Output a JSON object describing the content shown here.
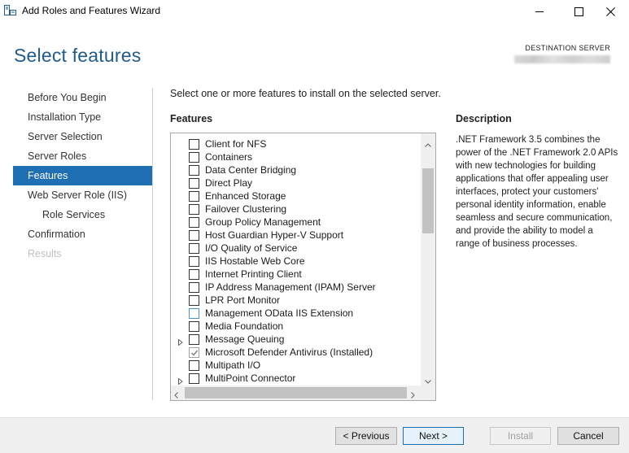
{
  "window": {
    "title": "Add Roles and Features Wizard",
    "icon": "server-manager-icon"
  },
  "header": {
    "page_title": "Select features",
    "destination_label": "DESTINATION SERVER"
  },
  "nav": {
    "items": [
      {
        "label": "Before You Begin",
        "state": "normal"
      },
      {
        "label": "Installation Type",
        "state": "normal"
      },
      {
        "label": "Server Selection",
        "state": "normal"
      },
      {
        "label": "Server Roles",
        "state": "normal"
      },
      {
        "label": "Features",
        "state": "active"
      },
      {
        "label": "Web Server Role (IIS)",
        "state": "normal"
      },
      {
        "label": "Role Services",
        "state": "sub"
      },
      {
        "label": "Confirmation",
        "state": "normal"
      },
      {
        "label": "Results",
        "state": "disabled"
      }
    ]
  },
  "main": {
    "instruction": "Select one or more features to install on the selected server.",
    "features_heading": "Features",
    "features": [
      {
        "label": "Client for NFS",
        "checked": false,
        "expandable": false
      },
      {
        "label": "Containers",
        "checked": false,
        "expandable": false
      },
      {
        "label": "Data Center Bridging",
        "checked": false,
        "expandable": false
      },
      {
        "label": "Direct Play",
        "checked": false,
        "expandable": false
      },
      {
        "label": "Enhanced Storage",
        "checked": false,
        "expandable": false
      },
      {
        "label": "Failover Clustering",
        "checked": false,
        "expandable": false
      },
      {
        "label": "Group Policy Management",
        "checked": false,
        "expandable": false
      },
      {
        "label": "Host Guardian Hyper-V Support",
        "checked": false,
        "expandable": false
      },
      {
        "label": "I/O Quality of Service",
        "checked": false,
        "expandable": false
      },
      {
        "label": "IIS Hostable Web Core",
        "checked": false,
        "expandable": false
      },
      {
        "label": "Internet Printing Client",
        "checked": false,
        "expandable": false
      },
      {
        "label": "IP Address Management (IPAM) Server",
        "checked": false,
        "expandable": false
      },
      {
        "label": "LPR Port Monitor",
        "checked": false,
        "expandable": false
      },
      {
        "label": "Management OData IIS Extension",
        "checked": false,
        "expandable": false,
        "hover": true
      },
      {
        "label": "Media Foundation",
        "checked": false,
        "expandable": false
      },
      {
        "label": "Message Queuing",
        "checked": false,
        "expandable": true
      },
      {
        "label": "Microsoft Defender Antivirus (Installed)",
        "checked": true,
        "expandable": false,
        "installed": true
      },
      {
        "label": "Multipath I/O",
        "checked": false,
        "expandable": false
      },
      {
        "label": "MultiPoint Connector",
        "checked": false,
        "expandable": true
      }
    ],
    "description_heading": "Description",
    "description_text": ".NET Framework 3.5 combines the power of the .NET Framework 2.0 APIs with new technologies for building applications that offer appealing user interfaces, protect your customers' personal identity information, enable seamless and secure communication, and provide the ability to model a range of business processes."
  },
  "footer": {
    "previous_label": "< Previous",
    "next_label": "Next >",
    "install_label": "Install",
    "cancel_label": "Cancel"
  },
  "colors": {
    "title_blue": "#1f5c8c",
    "active_nav": "#1f6fb5",
    "footer_bg": "#f0f0f0"
  }
}
